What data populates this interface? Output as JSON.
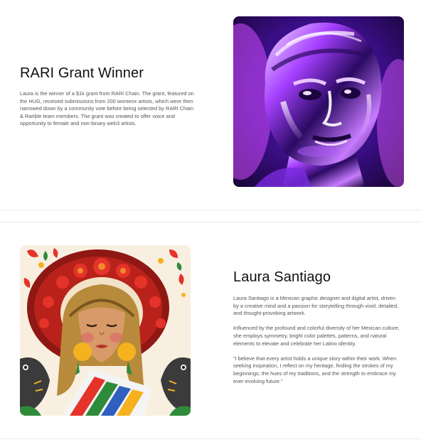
{
  "grant": {
    "title": "RARI Grant Winner",
    "description": "Laura is the winner of a $1k grant from RARI Chain. The grant, featured on the HUG, received submissions from 200 womenx artists, which were then narrowed down by a community vote before being selected by RARI Chain & Rarible team members. The grant was created to offer voice and opportunity to female and non-binary web3 artists.",
    "image_icon": "chrome-head-sculpture-image"
  },
  "artist": {
    "name": "Laura Santiago",
    "paragraphs": [
      "Laura Santiago is a Mexican graphic designer and digital artist, driven by a creative mind and a passion for storytelling through vivid, detailed, and thought-provoking artwork.",
      "Influenced by the profound and colorful diversity of her Mexican culture, she employs symmetry, bright color palettes, patterns, and natural elements to elevate and celebrate her Latino identity.",
      "“I believe that every artist holds a unique story within their work. When seeking inspiration, I reflect on my heritage, finding the strokes of my beginnings, the hues of my traditions, and the strength to embrace my ever-evolving future.”"
    ],
    "image_icon": "mexican-woman-portrait-illustration"
  },
  "colors": {
    "purple_dark": "#2a0b5e",
    "purple_bright": "#9b2cf0",
    "sombrero_red": "#b8221b",
    "marigold": "#f5b21e",
    "cream": "#f8efe0"
  }
}
